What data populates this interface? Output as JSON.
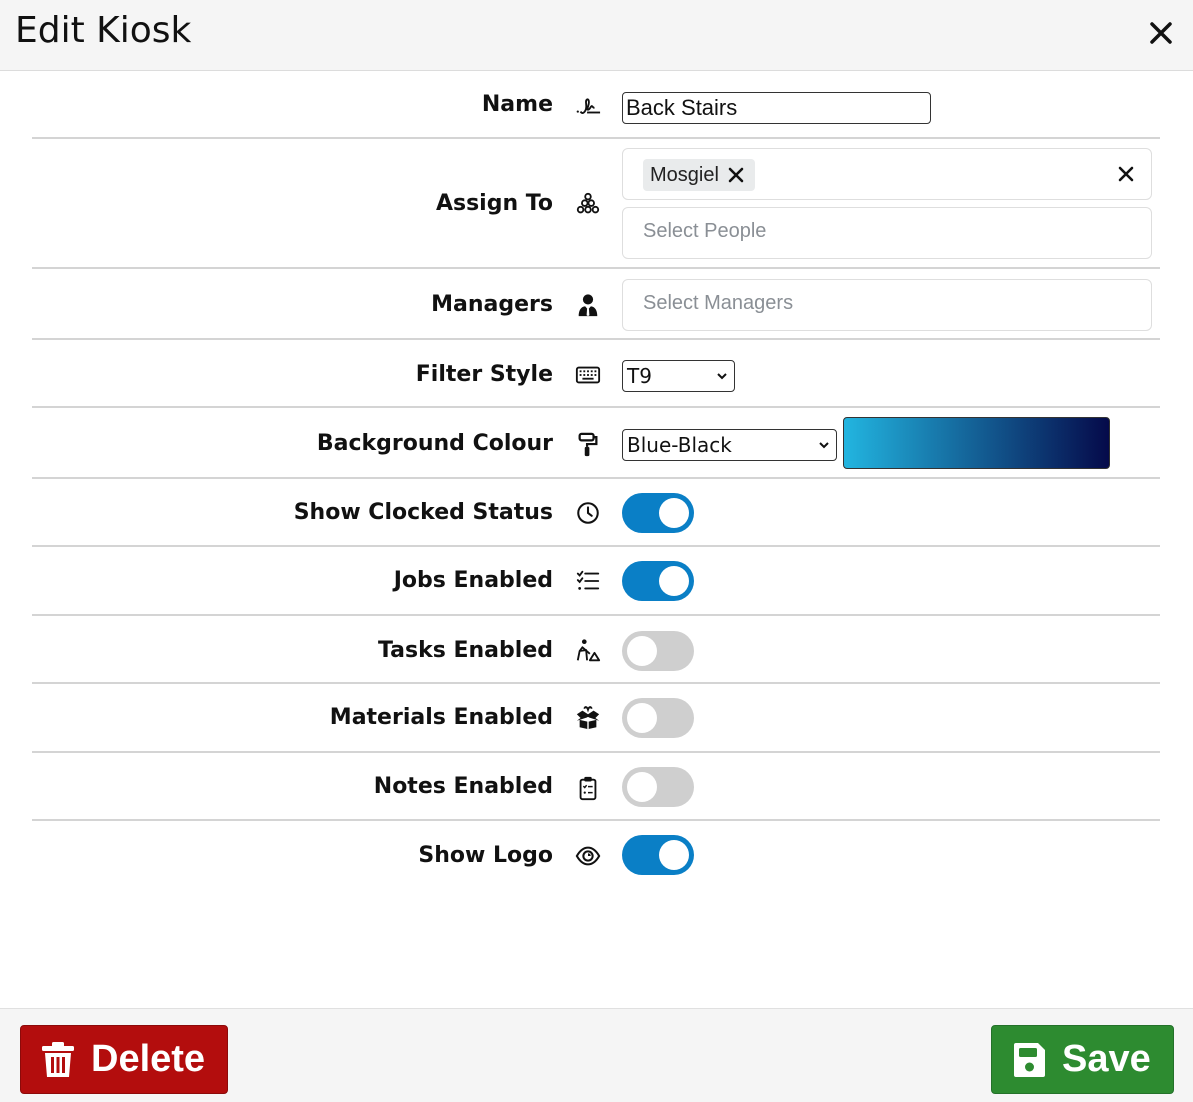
{
  "dialog": {
    "title": "Edit Kiosk",
    "close_icon": "close-icon"
  },
  "fields": {
    "name": {
      "label": "Name",
      "icon": "signature-icon",
      "value": "Back Stairs"
    },
    "assign_to": {
      "label": "Assign To",
      "icon": "people-group-icon",
      "chips": [
        "Mosgiel"
      ],
      "people_placeholder": "Select People"
    },
    "managers": {
      "label": "Managers",
      "icon": "user-tie-icon",
      "placeholder": "Select Managers"
    },
    "filter_style": {
      "label": "Filter Style",
      "icon": "keyboard-icon",
      "selected": "T9"
    },
    "background_colour": {
      "label": "Background Colour",
      "icon": "paint-roller-icon",
      "selected": "Blue-Black",
      "gradient_start": "#22b5e0",
      "gradient_end": "#050a4a"
    },
    "show_clocked_status": {
      "label": "Show Clocked Status",
      "icon": "clock-icon",
      "enabled": true
    },
    "jobs_enabled": {
      "label": "Jobs Enabled",
      "icon": "list-check-icon",
      "enabled": true
    },
    "tasks_enabled": {
      "label": "Tasks Enabled",
      "icon": "person-digging-icon",
      "enabled": false
    },
    "materials_enabled": {
      "label": "Materials Enabled",
      "icon": "box-open-icon",
      "enabled": false
    },
    "notes_enabled": {
      "label": "Notes Enabled",
      "icon": "clipboard-list-icon",
      "enabled": false
    },
    "show_logo": {
      "label": "Show Logo",
      "icon": "eye-icon",
      "enabled": true
    }
  },
  "colors": {
    "toggle_on": "#0a7fc6",
    "toggle_off": "#cfcfcf",
    "delete": "#b30d0d",
    "save": "#2d8b30"
  },
  "footer": {
    "delete_label": "Delete",
    "save_label": "Save"
  }
}
